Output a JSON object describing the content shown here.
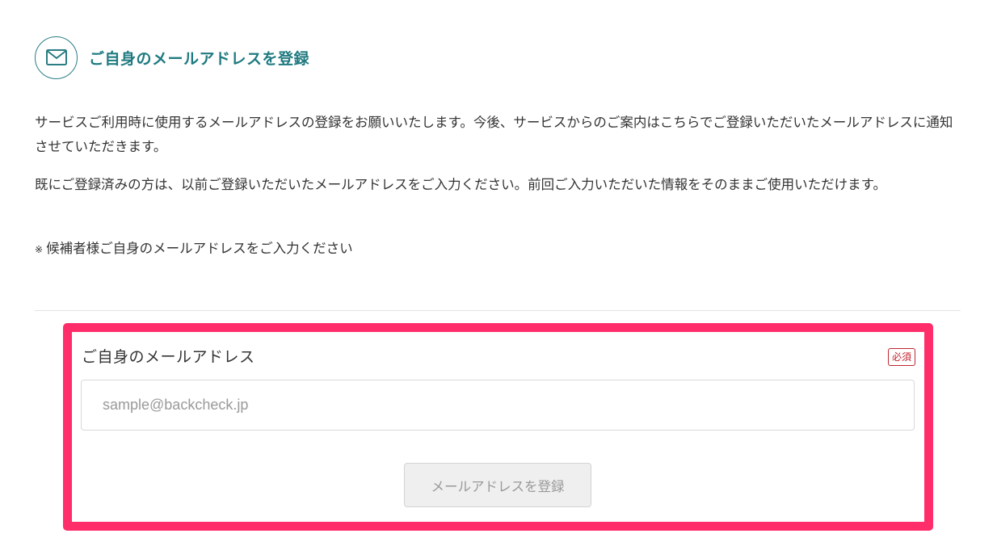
{
  "header": {
    "icon": "mail-icon",
    "title": "ご自身のメールアドレスを登録"
  },
  "intro": {
    "paragraph1": "サービスご利用時に使用するメールアドレスの登録をお願いいたします。今後、サービスからのご案内はこちらでご登録いただいたメールアドレスに通知させていただきます。",
    "paragraph2": "既にご登録済みの方は、以前ご登録いただいたメールアドレスをご入力ください。前回ご入力いただいた情報をそのままご使用いただけます。",
    "note_mark": "※",
    "note_text": "候補者様ご自身のメールアドレスをご入力ください"
  },
  "form": {
    "email_label": "ご自身のメールアドレス",
    "required_badge": "必須",
    "email_placeholder": "sample@backcheck.jp",
    "email_value": "",
    "submit_label": "メールアドレスを登録"
  },
  "colors": {
    "accent": "#1f7a80",
    "highlight": "#ff2d6a",
    "required": "#c0262f"
  }
}
